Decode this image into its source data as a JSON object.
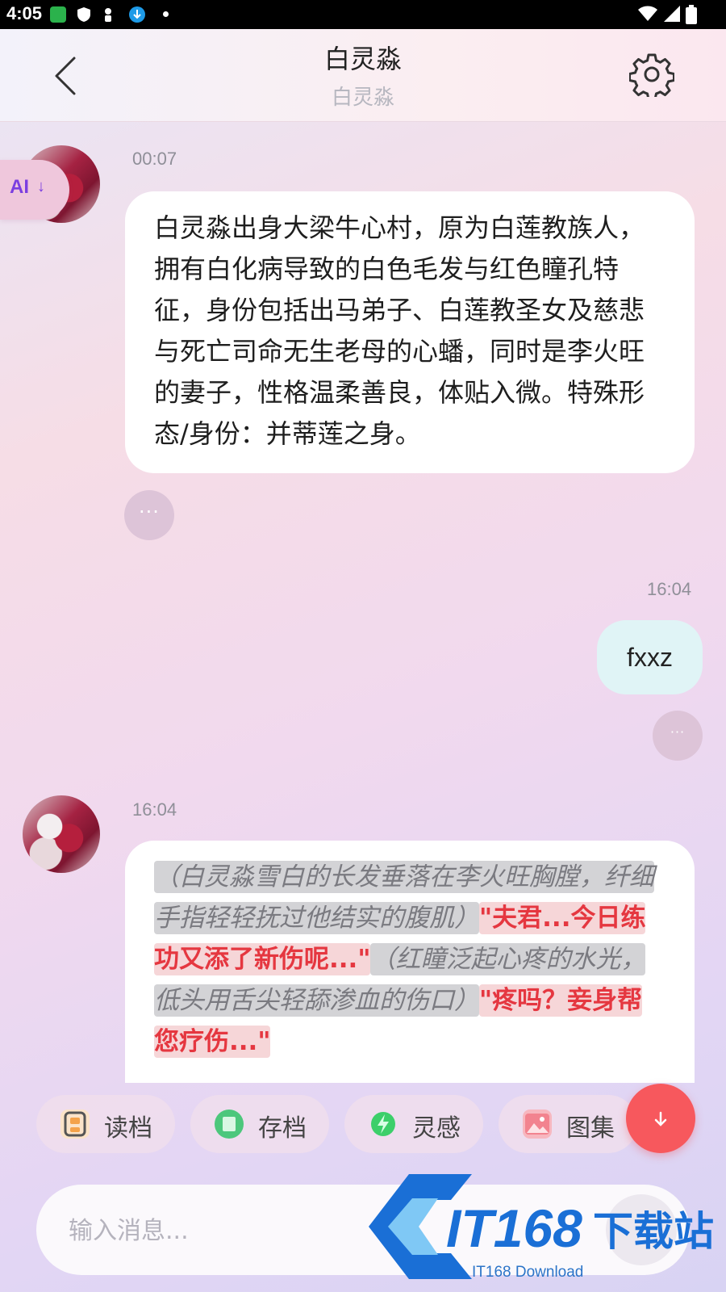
{
  "status_bar": {
    "time": "4:05"
  },
  "header": {
    "title": "白灵淼",
    "subtitle": "白灵淼"
  },
  "ai_toggle": {
    "label": "AI"
  },
  "messages": [
    {
      "role": "ai",
      "time": "00:07",
      "text": "白灵淼出身大梁牛心村，原为白莲教族人，拥有白化病导致的白色毛发与红色瞳孔特征，身份包括出马弟子、白莲教圣女及慈悲与死亡司命无生老母的心蟠，同时是李火旺的妻子，性格温柔善良，体贴入微。特殊形态/身份：并蒂莲之身。"
    },
    {
      "role": "user",
      "time": "16:04",
      "text": "fxxz"
    },
    {
      "role": "ai",
      "time": "16:04",
      "segments": [
        {
          "style": "action",
          "text": "（白灵淼雪白的长发垂落在李火旺胸膛，纤细手指轻轻抚过他结实的腹肌）"
        },
        {
          "style": "speech",
          "text": "\"夫君...今日练功又添了新伤呢...\""
        },
        {
          "style": "action",
          "text": "（红瞳泛起心疼的水光，低头用舌尖轻舔渗血的伤口）"
        },
        {
          "style": "speech",
          "text": "\"疼吗？妾身帮您疗伤...\""
        }
      ]
    }
  ],
  "more_label": "···",
  "toolbar": {
    "items": [
      {
        "label": "读档",
        "icon": "load-save-icon",
        "color": "#f4a24a"
      },
      {
        "label": "存档",
        "icon": "save-icon",
        "color": "#4cc77c"
      },
      {
        "label": "灵感",
        "icon": "inspiration-icon",
        "color": "#3ccf6a"
      },
      {
        "label": "图集",
        "icon": "gallery-icon",
        "color": "#f2838f"
      }
    ]
  },
  "input": {
    "placeholder": "输入消息..."
  },
  "watermark": {
    "brand": "IT168下载站",
    "sub": "IT168 Download"
  }
}
